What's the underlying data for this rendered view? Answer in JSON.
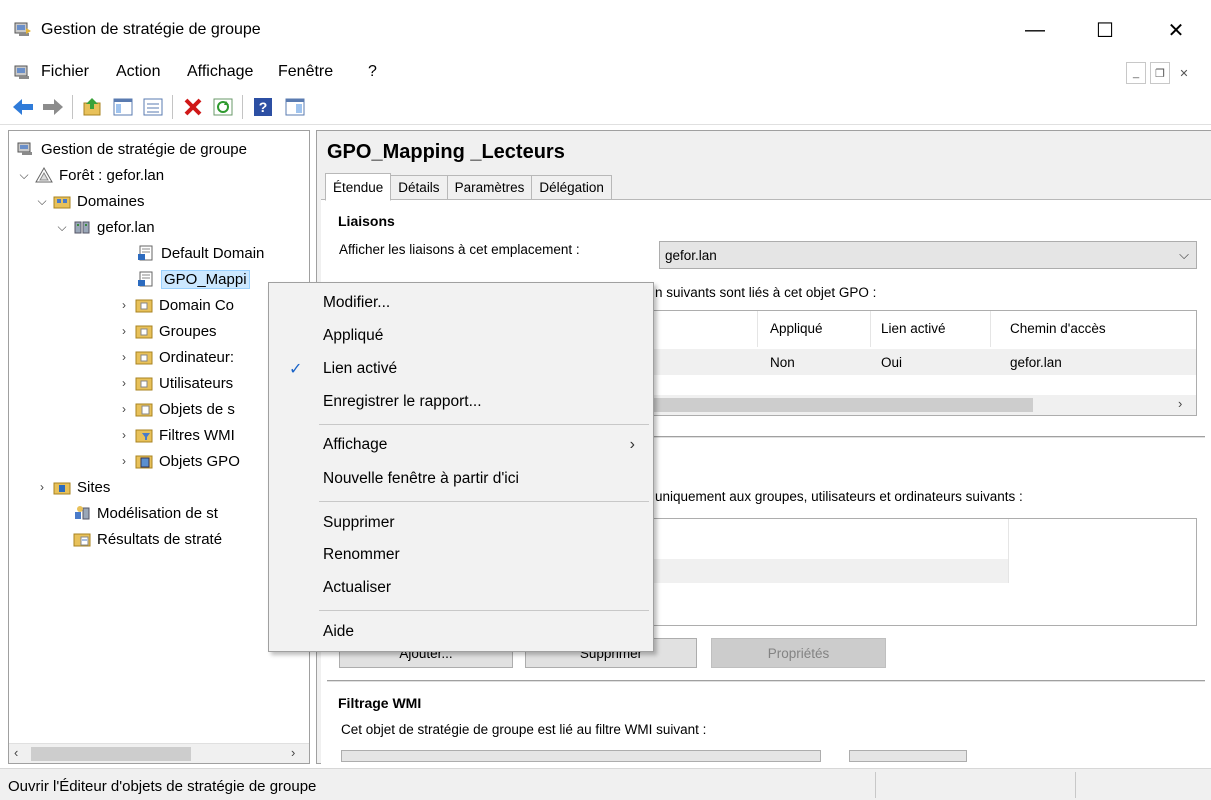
{
  "window": {
    "title": "Gestion de stratégie de groupe",
    "minimize": "—",
    "maximize": "☐",
    "close": "✕"
  },
  "menu": {
    "items": [
      "Fichier",
      "Action",
      "Affichage",
      "Fenêtre",
      "?"
    ],
    "mdi_min": "_",
    "mdi_restore": "❐",
    "mdi_close": "✕"
  },
  "tree": {
    "items": [
      {
        "label": "Gestion de stratégie de groupe",
        "arrow": ""
      },
      {
        "label": "Forêt : gefor.lan",
        "arrow": "⌵"
      },
      {
        "label": "Domaines",
        "arrow": "⌵"
      },
      {
        "label": "gefor.lan",
        "arrow": "⌵"
      },
      {
        "label": "Default Domain",
        "arrow": ""
      },
      {
        "label": "GPO_Mappi",
        "arrow": ""
      },
      {
        "label": "Domain Co",
        "arrow": "›"
      },
      {
        "label": "Groupes",
        "arrow": "›"
      },
      {
        "label": "Ordinateur:",
        "arrow": "›"
      },
      {
        "label": "Utilisateurs",
        "arrow": "›"
      },
      {
        "label": "Objets de s",
        "arrow": "›"
      },
      {
        "label": "Filtres WMI",
        "arrow": "›"
      },
      {
        "label": "Objets GPO",
        "arrow": "›"
      },
      {
        "label": "Sites",
        "arrow": "›"
      },
      {
        "label": "Modélisation de st",
        "arrow": ""
      },
      {
        "label": "Résultats de straté",
        "arrow": ""
      }
    ],
    "scroll_left": "‹",
    "scroll_right": "›"
  },
  "gpo": {
    "title": "GPO_Mapping _Lecteurs",
    "tabs": [
      "Étendue",
      "Détails",
      "Paramètres",
      "Délégation"
    ],
    "liaisons_title": "Liaisons",
    "show_links_label": "Afficher les liaisons à cet emplacement :",
    "location_value": "gefor.lan",
    "linked_text": "n suivants sont liés à cet objet GPO :",
    "columns": [
      "Appliqué",
      "Lien activé",
      "Chemin d'accès"
    ],
    "row": [
      "Non",
      "Oui",
      "gefor.lan"
    ],
    "filter_text": "uniquement aux groupes, utilisateurs et ordinateurs suivants :",
    "buttons": [
      "Ajouter...",
      "Supprimer",
      "Propriétés"
    ],
    "wmi_title": "Filtrage WMI",
    "wmi_text": "Cet objet de stratégie de groupe est lié au filtre WMI suivant :",
    "scroll_right": "›"
  },
  "context_menu": {
    "items": [
      {
        "label": "Modifier..."
      },
      {
        "label": "Appliqué"
      },
      {
        "label": "Lien activé",
        "check": "✓"
      },
      {
        "label": "Enregistrer le rapport..."
      },
      {
        "label": "Affichage",
        "sub": "›"
      },
      {
        "label": "Nouvelle fenêtre à partir d'ici"
      },
      {
        "label": "Supprimer"
      },
      {
        "label": "Renommer"
      },
      {
        "label": "Actualiser"
      },
      {
        "label": "Aide"
      }
    ]
  },
  "status": {
    "text": "Ouvrir l'Éditeur d'objets de stratégie de groupe"
  },
  "colors": {
    "accent": "#1a64c8",
    "selection": "#cce8ff",
    "delete_red": "#d01818"
  }
}
